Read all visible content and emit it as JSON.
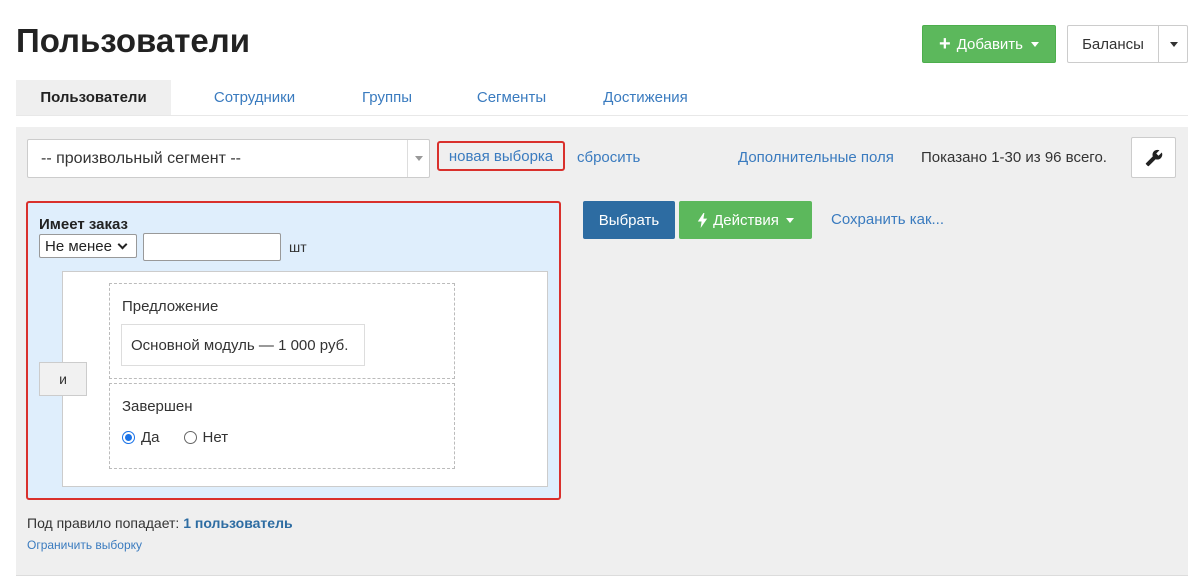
{
  "page": {
    "title": "Пользователи"
  },
  "header": {
    "add_button_label": "Добавить",
    "balances_button_label": "Балансы"
  },
  "tabs": [
    {
      "label": "Пользователи",
      "active": true
    },
    {
      "label": "Сотрудники",
      "active": false
    },
    {
      "label": "Группы",
      "active": false
    },
    {
      "label": "Сегменты",
      "active": false
    },
    {
      "label": "Достижения",
      "active": false
    }
  ],
  "toolbar": {
    "segment_select_value": "-- произвольный сегмент --",
    "new_selection_link": "новая выборка",
    "reset_link": "сбросить",
    "extra_fields_link": "Дополнительные поля",
    "shown_text": "Показано 1-30 из 96 всего."
  },
  "rule": {
    "title": "Имеет заказ",
    "compare_select_value": "Не менее",
    "quantity_value": "",
    "unit": "шт",
    "connector_label": "и",
    "conditions": {
      "offer_label": "Предложение",
      "offer_value": "Основной модуль — 1 000 руб.",
      "completed_label": "Завершен",
      "completed_options": [
        {
          "label": "Да",
          "checked": true
        },
        {
          "label": "Нет",
          "checked": false
        }
      ]
    }
  },
  "actions": {
    "select_button": "Выбрать",
    "actions_button": "Действия",
    "save_as_link": "Сохранить как..."
  },
  "footer": {
    "count_prefix": "Под правило попадает:",
    "count_value": "1 пользователь",
    "limit_link": "Ограничить выборку"
  },
  "colors": {
    "primary_green": "#5cb85c",
    "primary_blue": "#2d6ca2",
    "link_blue": "#3a7bbf",
    "highlight_red": "#d9302c",
    "rule_background": "#dfeefc"
  },
  "icons": {
    "add": "plus-icon",
    "dropdown": "caret-down-icon",
    "settings": "wrench-icon",
    "actions": "lightning-icon"
  }
}
